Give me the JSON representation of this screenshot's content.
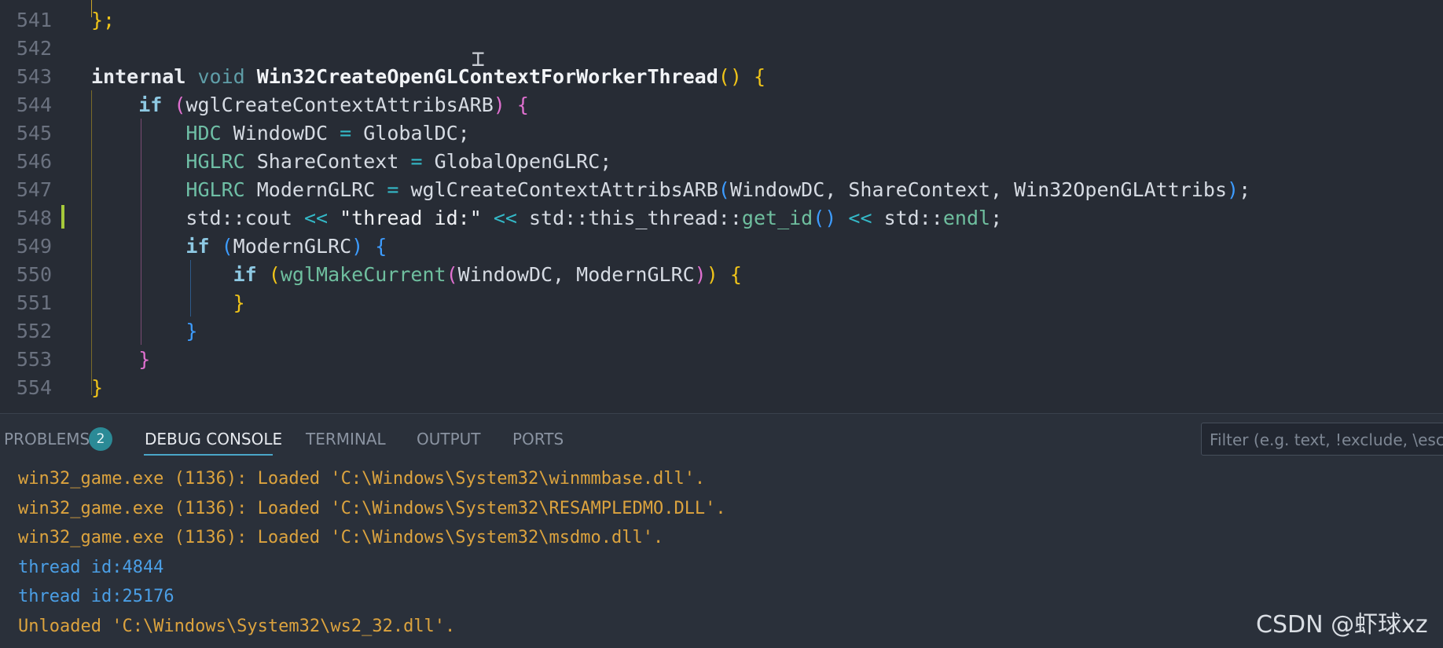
{
  "editor": {
    "lines": {
      "l541": {
        "num": "541",
        "t1": "};"
      },
      "l542": {
        "num": "542"
      },
      "l543": {
        "num": "543",
        "kw": "internal",
        "void": "void",
        "fn": "Win32CreateOpenGLContextForWorkerThread",
        "paren": "()",
        "brace": "{"
      },
      "l544": {
        "num": "544",
        "kw": "if",
        "po": "(",
        "ident": "wglCreateContextAttribsARB",
        "pc": ")",
        "brace": "{"
      },
      "l545": {
        "num": "545",
        "ty": "HDC",
        "rest": "WindowDC",
        "eq": "=",
        "val": "GlobalDC;"
      },
      "l546": {
        "num": "546",
        "ty": "HGLRC",
        "rest": "ShareContext",
        "eq": "=",
        "val": "GlobalOpenGLRC;"
      },
      "l547": {
        "num": "547",
        "ty": "HGLRC",
        "rest": "ModernGLRC",
        "eq": "=",
        "fn": "wglCreateContextAttribsARB",
        "po": "(",
        "args": "WindowDC, ShareContext, Win32OpenGLAttribs",
        "pc": ")",
        "end": ";"
      },
      "l548": {
        "num": "548",
        "a": "std::cout",
        "op1": "<<",
        "str": "\"thread id:\"",
        "op2": "<<",
        "b": "std::this_thread::",
        "fn": "get_id",
        "pp": "()",
        "op3": "<<",
        "c": "std::",
        "endl": "endl",
        "end": ";"
      },
      "l549": {
        "num": "549",
        "kw": "if",
        "po": "(",
        "ident": "ModernGLRC",
        "pc": ")",
        "brace": "{"
      },
      "l550": {
        "num": "550",
        "kw": "if",
        "po": "(",
        "fn": "wglMakeCurrent",
        "po2": "(",
        "args": "WindowDC, ModernGLRC",
        "pc2": ")",
        "pc": ")",
        "brace": "{"
      },
      "l551": {
        "num": "551",
        "brace": "}"
      },
      "l552": {
        "num": "552",
        "brace": "}"
      },
      "l553": {
        "num": "553",
        "brace": "}"
      },
      "l554": {
        "num": "554",
        "brace": "}"
      }
    }
  },
  "panel": {
    "tabs": {
      "problems": "PROBLEMS",
      "problems_count": "2",
      "debug_console": "DEBUG CONSOLE",
      "terminal": "TERMINAL",
      "output": "OUTPUT",
      "ports": "PORTS"
    },
    "filter_placeholder": "Filter (e.g. text, !exclude, \\escape)",
    "output_lines": [
      "win32_game.exe (1136): Loaded 'C:\\Windows\\System32\\winmmbase.dll'.",
      "win32_game.exe (1136): Loaded 'C:\\Windows\\System32\\RESAMPLEDMO.DLL'.",
      "win32_game.exe (1136): Loaded 'C:\\Windows\\System32\\msdmo.dll'.",
      "thread id:4844",
      "thread id:25176",
      "Unloaded 'C:\\Windows\\System32\\ws2_32.dll'."
    ]
  },
  "watermark": "CSDN @虾球xz"
}
